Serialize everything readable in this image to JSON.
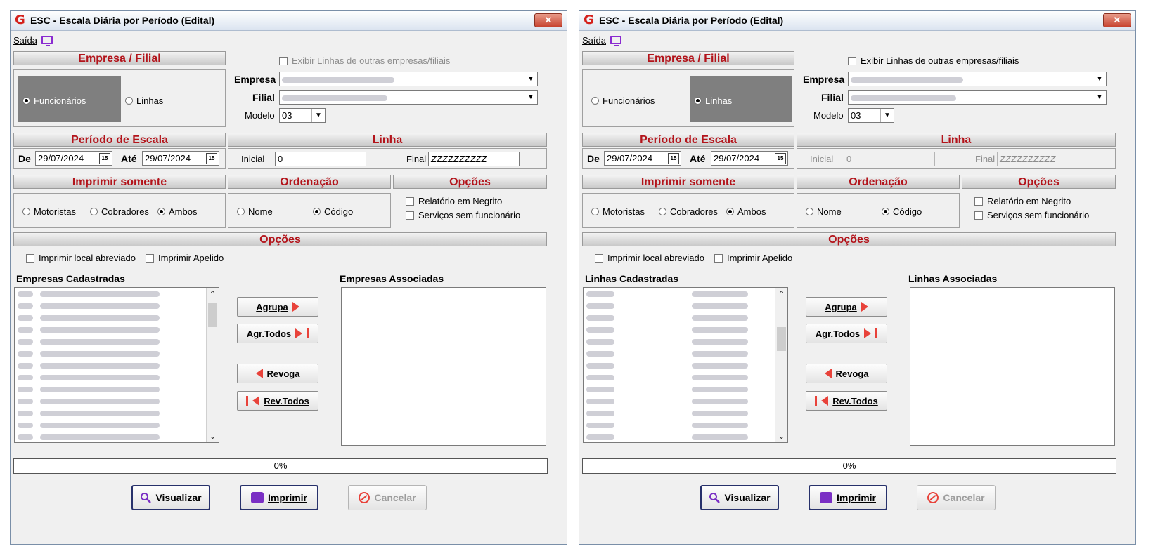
{
  "windows": [
    {
      "title": "ESC - Escala Diária por Período (Edital)",
      "close": "✕",
      "menu": {
        "saida": "Saída"
      },
      "empresa_filial": {
        "header": "Empresa / Filial",
        "radio_funcionarios": "Funcionários",
        "radio_linhas": "Linhas",
        "selected": "Funcionários"
      },
      "exibir": {
        "label": "Exibir Linhas de outras empresas/filiais",
        "enabled": false
      },
      "empresa": {
        "label": "Empresa"
      },
      "filial": {
        "label": "Filial"
      },
      "modelo": {
        "label": "Modelo",
        "value": "03"
      },
      "periodo": {
        "header": "Período de Escala",
        "de_label": "De",
        "de_value": "29/07/2024",
        "ate_label": "Até",
        "ate_value": "29/07/2024"
      },
      "linha": {
        "header": "Linha",
        "inicial_label": "Inicial",
        "inicial_value": "0",
        "final_label": "Final",
        "final_value": "ZZZZZZZZZZ",
        "enabled": true
      },
      "imprimir_somente": {
        "header": "Imprimir somente",
        "motoristas": "Motoristas",
        "cobradores": "Cobradores",
        "ambos": "Ambos",
        "selected": "Ambos"
      },
      "ordenacao": {
        "header": "Ordenação",
        "nome": "Nome",
        "codigo": "Código",
        "selected": "Código"
      },
      "opcoes": {
        "header": "Opções",
        "negrito": "Relatório em Negrito",
        "sem_func": "Serviços sem funcionário"
      },
      "opcoes2": {
        "header": "Opções",
        "local": "Imprimir local abreviado",
        "apelido": "Imprimir Apelido"
      },
      "list_left": {
        "title": "Empresas Cadastradas"
      },
      "list_right": {
        "title": "Empresas Associadas"
      },
      "buttons": {
        "agrupa": "Agrupa",
        "agr_todos": "Agr.Todos",
        "revoga": "Revoga",
        "rev_todos": "Rev.Todos"
      },
      "progress": "0%",
      "actions": {
        "visualizar": "Visualizar",
        "imprimir": "Imprimir",
        "cancelar": "Cancelar"
      }
    },
    {
      "title": "ESC - Escala Diária por Período (Edital)",
      "close": "✕",
      "menu": {
        "saida": "Saída"
      },
      "empresa_filial": {
        "header": "Empresa / Filial",
        "radio_funcionarios": "Funcionários",
        "radio_linhas": "Linhas",
        "selected": "Linhas"
      },
      "exibir": {
        "label": "Exibir Linhas de outras empresas/filiais",
        "enabled": true
      },
      "empresa": {
        "label": "Empresa"
      },
      "filial": {
        "label": "Filial"
      },
      "modelo": {
        "label": "Modelo",
        "value": "03"
      },
      "periodo": {
        "header": "Período de Escala",
        "de_label": "De",
        "de_value": "29/07/2024",
        "ate_label": "Até",
        "ate_value": "29/07/2024"
      },
      "linha": {
        "header": "Linha",
        "inicial_label": "Inicial",
        "inicial_value": "0",
        "final_label": "Final",
        "final_value": "ZZZZZZZZZZ",
        "enabled": false
      },
      "imprimir_somente": {
        "header": "Imprimir somente",
        "motoristas": "Motoristas",
        "cobradores": "Cobradores",
        "ambos": "Ambos",
        "selected": "Ambos"
      },
      "ordenacao": {
        "header": "Ordenação",
        "nome": "Nome",
        "codigo": "Código",
        "selected": "Código"
      },
      "opcoes": {
        "header": "Opções",
        "negrito": "Relatório em Negrito",
        "sem_func": "Serviços sem funcionário"
      },
      "opcoes2": {
        "header": "Opções",
        "local": "Imprimir local abreviado",
        "apelido": "Imprimir Apelido"
      },
      "list_left": {
        "title": "Linhas Cadastradas"
      },
      "list_right": {
        "title": "Linhas Associadas"
      },
      "buttons": {
        "agrupa": "Agrupa",
        "agr_todos": "Agr.Todos",
        "revoga": "Revoga",
        "rev_todos": "Rev.Todos"
      },
      "progress": "0%",
      "actions": {
        "visualizar": "Visualizar",
        "imprimir": "Imprimir",
        "cancelar": "Cancelar"
      }
    }
  ]
}
